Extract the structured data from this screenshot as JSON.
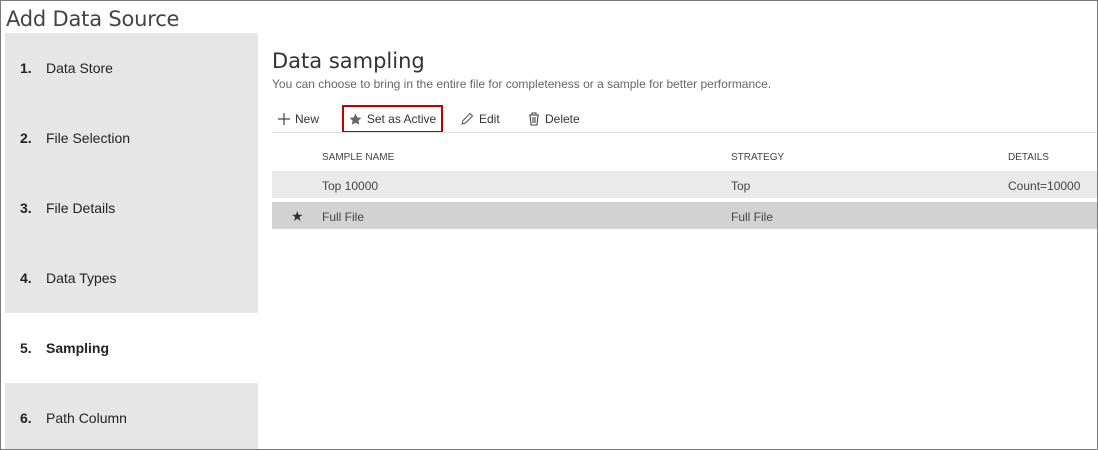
{
  "window": {
    "title": "Add Data Source"
  },
  "steps": [
    {
      "num": "1.",
      "label": "Data Store"
    },
    {
      "num": "2.",
      "label": "File Selection"
    },
    {
      "num": "3.",
      "label": "File Details"
    },
    {
      "num": "4.",
      "label": "Data Types"
    },
    {
      "num": "5.",
      "label": "Sampling"
    },
    {
      "num": "6.",
      "label": "Path Column"
    }
  ],
  "active_step": "5. Sampling",
  "main": {
    "title": "Data sampling",
    "subtitle": "You can choose to bring in the entire file for completeness or a sample for better performance."
  },
  "toolbar": {
    "new_label": "New",
    "set_active_label": "Set as Active",
    "edit_label": "Edit",
    "delete_label": "Delete",
    "highlight_color": "#c00000"
  },
  "table": {
    "headers": {
      "name": "SAMPLE NAME",
      "strategy": "STRATEGY",
      "details": "DETAILS"
    },
    "rows": [
      {
        "active": "",
        "name": "Top 10000",
        "strategy": "Top",
        "details": "Count=10000"
      },
      {
        "active": "★",
        "name": "Full File",
        "strategy": "Full File",
        "details": ""
      }
    ]
  }
}
